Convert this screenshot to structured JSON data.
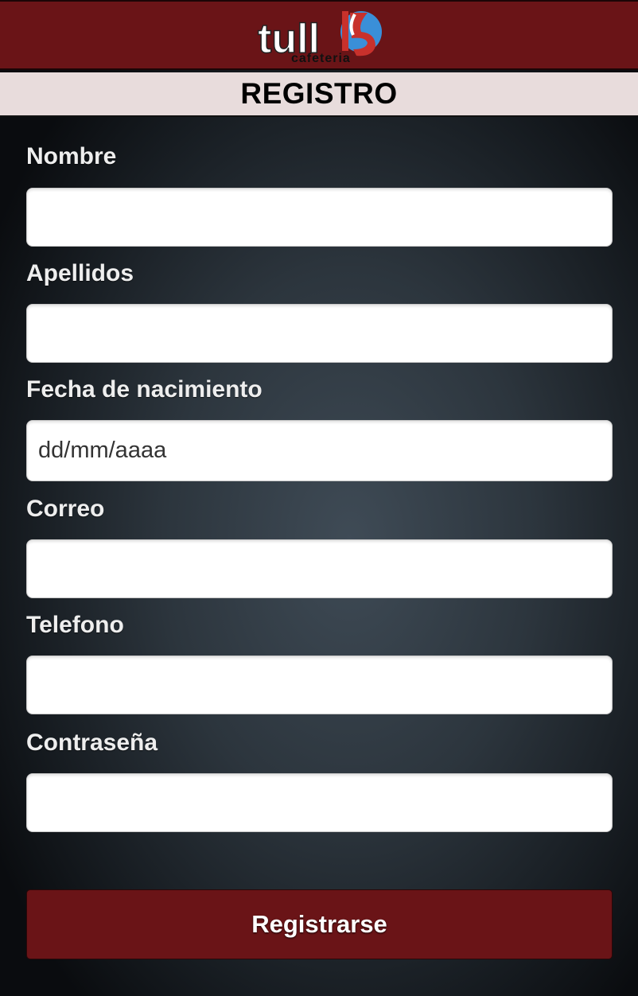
{
  "header": {
    "logo_text": "tull",
    "logo_subtext": "cafeteria"
  },
  "page": {
    "title": "REGISTRO"
  },
  "form": {
    "fields": [
      {
        "label": "Nombre",
        "value": "",
        "placeholder": ""
      },
      {
        "label": "Apellidos",
        "value": "",
        "placeholder": ""
      },
      {
        "label": "Fecha de nacimiento",
        "value": "",
        "placeholder": "dd/mm/aaaa"
      },
      {
        "label": "Correo",
        "value": "",
        "placeholder": ""
      },
      {
        "label": "Telefono",
        "value": "",
        "placeholder": ""
      },
      {
        "label": "Contraseña",
        "value": "",
        "placeholder": ""
      }
    ],
    "submit_label": "Registrarse"
  },
  "colors": {
    "brand_red": "#6a1417",
    "title_bar_bg": "#e8dcdc",
    "logo_blue": "#3a8fd8",
    "logo_accent_red": "#c8312c"
  }
}
